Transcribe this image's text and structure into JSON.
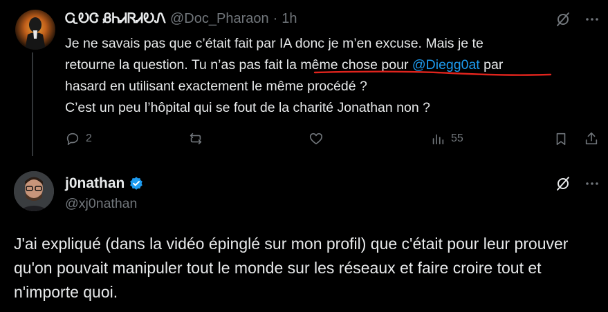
{
  "tweet1": {
    "display_name": "ᏩᎧᏣ ᏰᏂᏗᏒᏗᎧᏁ",
    "handle": "@Doc_Pharaon",
    "separator": "·",
    "time": "1h",
    "body_line1": "Je ne savais pas que c’était fait par IA donc je m’en excuse. Mais je te",
    "body_line2_pre": "retourne la question. Tu n’as pas fait la même chose pour ",
    "body_mention": "@Diegg0at",
    "body_line2_post": " par",
    "body_line3": "hasard en utilisant exactement le même procédé ?",
    "body_line4": "C’est un peu l’hôpital qui se fout de la charité Jonathan non ?",
    "actions": {
      "reply_count": "2",
      "repost_count": "",
      "like_count": "",
      "views_count": "55"
    }
  },
  "tweet2": {
    "display_name": "j0nathan",
    "handle": "@xj0nathan",
    "body": "J'ai expliqué (dans la vidéo épinglé sur mon profil) que c'était pour leur prouver qu'on pouvait manipuler tout le monde sur les réseaux et faire croire tout et n'importe quoi."
  },
  "icons": {
    "verified": "verified-badge-icon",
    "grok": "grok-icon",
    "more": "more-icon",
    "reply": "reply-icon",
    "repost": "repost-icon",
    "like": "like-icon",
    "views": "views-icon",
    "bookmark": "bookmark-icon",
    "share": "share-icon"
  },
  "colors": {
    "background": "#000000",
    "text": "#e7e9ea",
    "muted": "#71767b",
    "link": "#1d9bf0",
    "verified": "#1d9bf0",
    "annotation": "#e0241d"
  }
}
